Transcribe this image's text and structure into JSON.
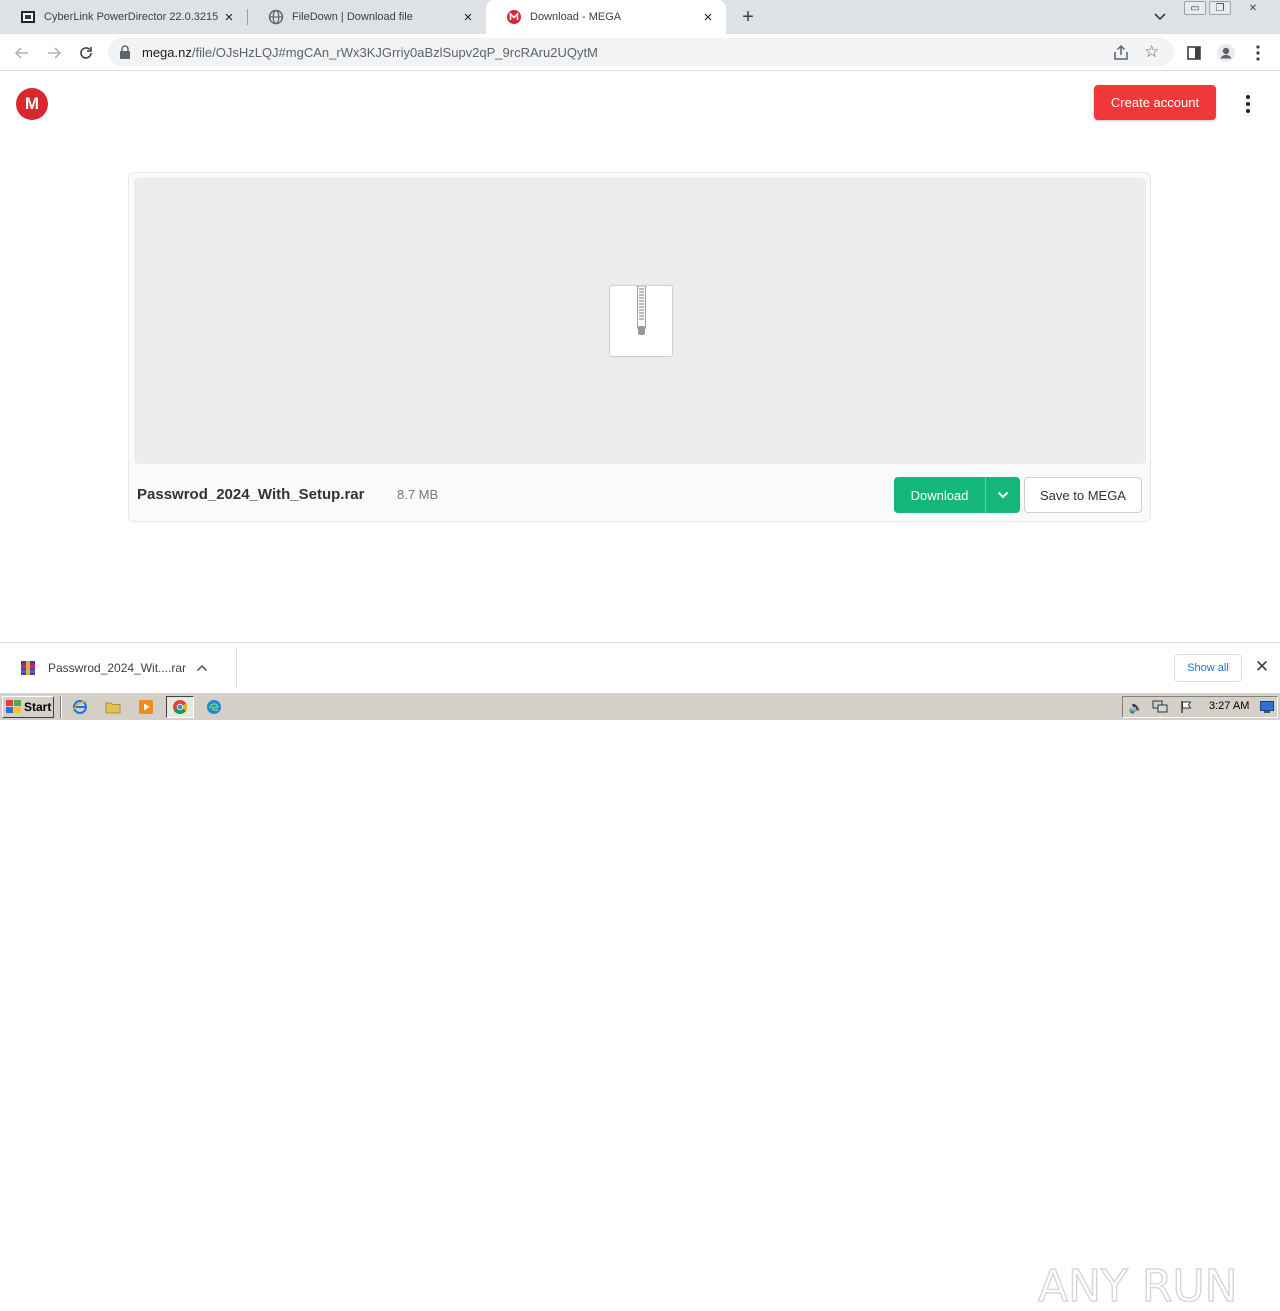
{
  "browser": {
    "tabs": [
      {
        "title": "CyberLink PowerDirector 22.0.3215",
        "icon": "cyberlink-icon"
      },
      {
        "title": "FileDown | Download file",
        "icon": "globe-icon"
      },
      {
        "title": "Download - MEGA",
        "icon": "mega-icon",
        "active": true
      }
    ],
    "url_domain": "mega.nz",
    "url_path": "/file/OJsHzLQJ#mgCAn_rWx3KJGrriy0aBzlSupv2qP_9rcRAru2UQytM"
  },
  "page": {
    "logo_letter": "M",
    "create_account_label": "Create account",
    "file_name": "Passwrod_2024_With_Setup.rar",
    "file_size": "8.7 MB",
    "download_label": "Download",
    "save_label": "Save to MEGA",
    "accent_red": "#f0373a",
    "accent_green": "#15b67a"
  },
  "download_shelf": {
    "item_name": "Passwrod_2024_Wit....rar",
    "show_all_label": "Show all",
    "watermark_text": "ANY RUN"
  },
  "taskbar": {
    "start_label": "Start",
    "clock": "3:27 AM"
  }
}
